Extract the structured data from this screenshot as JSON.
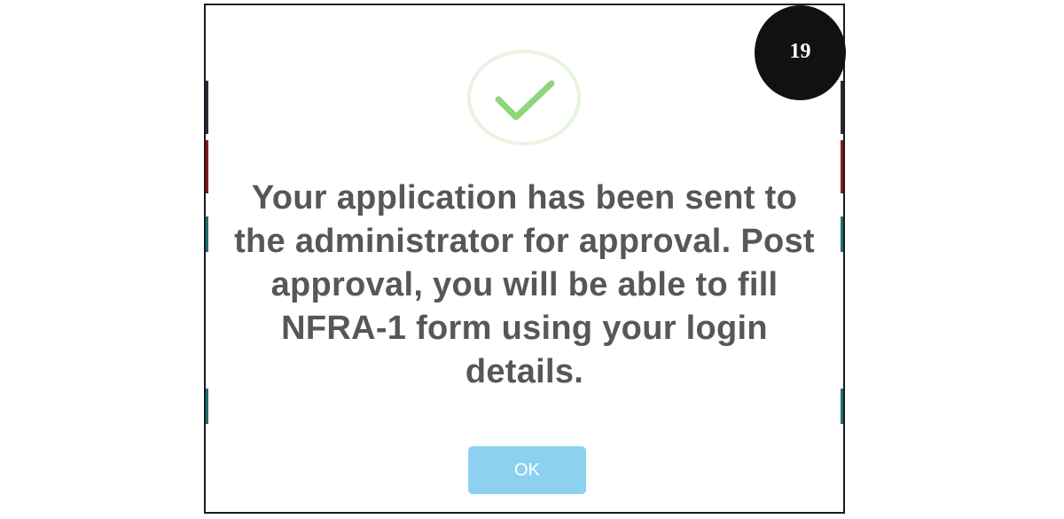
{
  "dialog": {
    "icon": "checkmark-circle-icon",
    "message": "Your application has been sent to the administrator for approval. Post approval, you will be able to fill NFRA-1 form using your login details.",
    "ok_label": "OK"
  },
  "step_badge": {
    "number": "19"
  },
  "colors": {
    "check": "#8fd57a",
    "ring": "#e6f4e1",
    "message_text": "#575757",
    "ok_button": "#8dd1f1",
    "badge": "#111111"
  }
}
